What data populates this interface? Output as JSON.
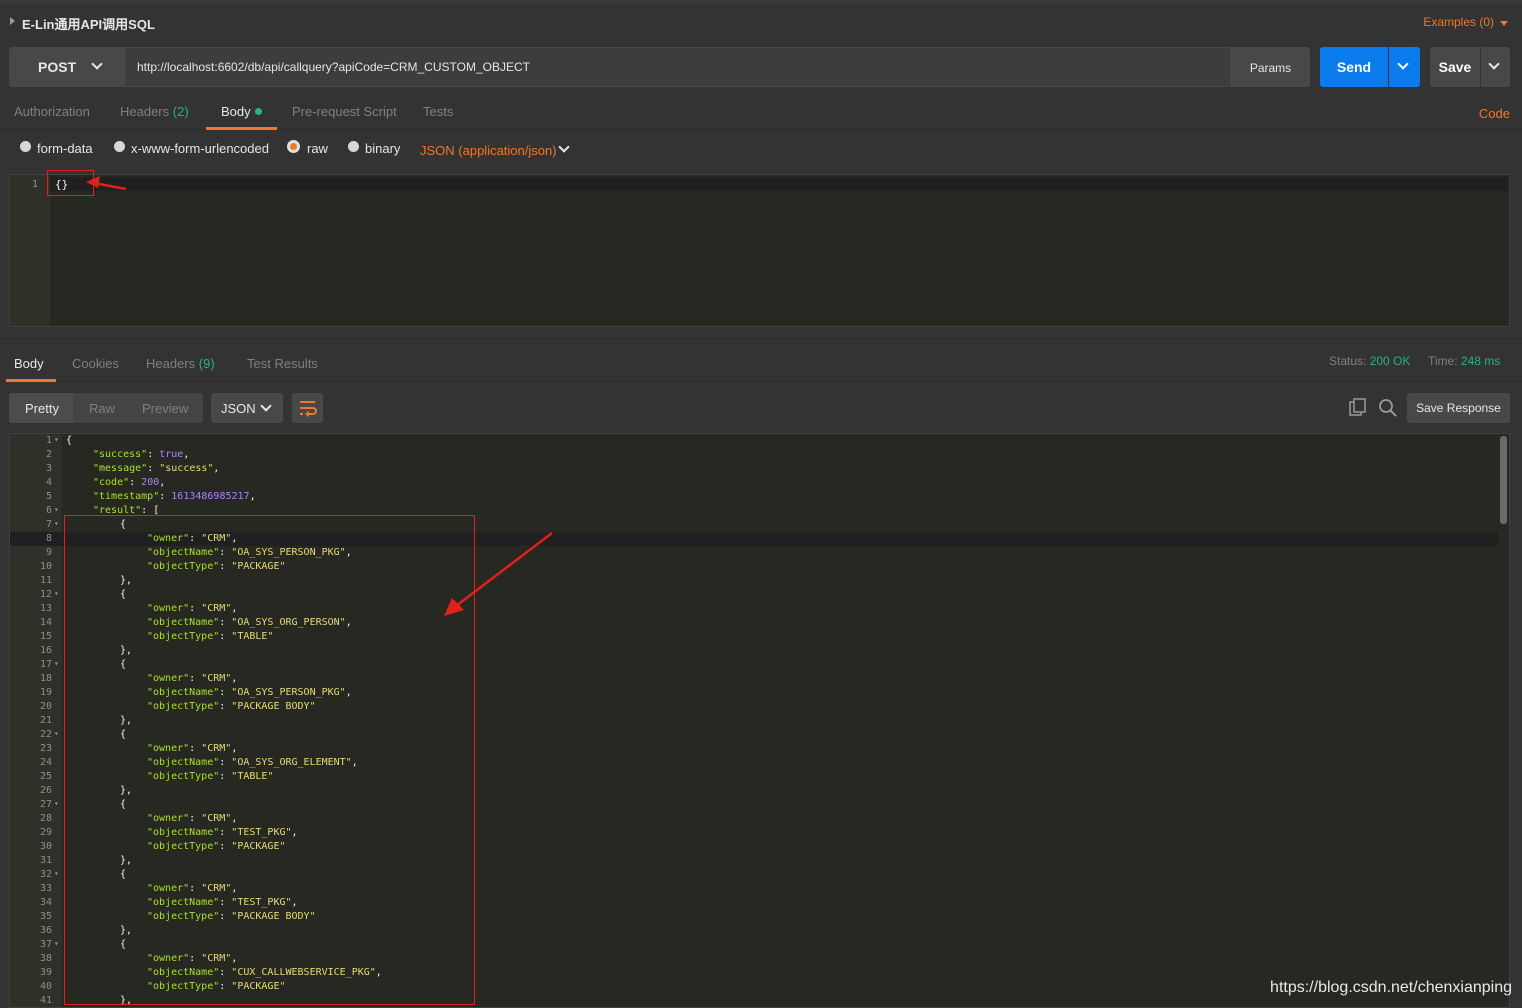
{
  "header": {
    "title": "E-Lin通用API调用SQL",
    "examples_label": "Examples (0)"
  },
  "request": {
    "method": "POST",
    "url": "http://localhost:6602/db/api/callquery?apiCode=CRM_CUSTOM_OBJECT",
    "params_label": "Params",
    "send_label": "Send",
    "save_label": "Save"
  },
  "request_tabs": {
    "authorization": "Authorization",
    "headers": "Headers",
    "headers_count": "(2)",
    "body": "Body",
    "pre_request": "Pre-request Script",
    "tests": "Tests",
    "code_link": "Code"
  },
  "body_options": {
    "form_data": "form-data",
    "urlencoded": "x-www-form-urlencoded",
    "raw": "raw",
    "binary": "binary",
    "content_type": "JSON (application/json)",
    "selected": "raw"
  },
  "request_editor": {
    "line_number": "1",
    "content": "{}"
  },
  "response_tabs": {
    "body": "Body",
    "cookies": "Cookies",
    "headers": "Headers",
    "headers_count": "(9)",
    "test_results": "Test Results"
  },
  "response_status": {
    "status_label": "Status:",
    "status_value": "200 OK",
    "time_label": "Time:",
    "time_value": "248 ms"
  },
  "response_toolbar": {
    "pretty": "Pretty",
    "raw": "Raw",
    "preview": "Preview",
    "format": "JSON",
    "save_response": "Save Response"
  },
  "response_lines": [
    {
      "n": "1",
      "fold": true,
      "indent": 0,
      "tokens": [
        [
          "p",
          "{"
        ]
      ]
    },
    {
      "n": "2",
      "indent": 1,
      "tokens": [
        [
          "k",
          "\"success\""
        ],
        [
          "p",
          ": "
        ],
        [
          "b",
          "true"
        ],
        [
          "p",
          ","
        ]
      ]
    },
    {
      "n": "3",
      "indent": 1,
      "tokens": [
        [
          "k",
          "\"message\""
        ],
        [
          "p",
          ": "
        ],
        [
          "s",
          "\"success\""
        ],
        [
          "p",
          ","
        ]
      ]
    },
    {
      "n": "4",
      "indent": 1,
      "tokens": [
        [
          "k",
          "\"code\""
        ],
        [
          "p",
          ": "
        ],
        [
          "n",
          "200"
        ],
        [
          "p",
          ","
        ]
      ]
    },
    {
      "n": "5",
      "indent": 1,
      "tokens": [
        [
          "k",
          "\"timestamp\""
        ],
        [
          "p",
          ": "
        ],
        [
          "n",
          "1613486985217"
        ],
        [
          "p",
          ","
        ]
      ]
    },
    {
      "n": "6",
      "fold": true,
      "indent": 1,
      "tokens": [
        [
          "k",
          "\"result\""
        ],
        [
          "p",
          ": ["
        ]
      ]
    },
    {
      "n": "7",
      "fold": true,
      "indent": 2,
      "tokens": [
        [
          "p",
          "{"
        ]
      ]
    },
    {
      "n": "8",
      "indent": 3,
      "tokens": [
        [
          "k",
          "\"owner\""
        ],
        [
          "p",
          ": "
        ],
        [
          "s",
          "\"CRM\""
        ],
        [
          "p",
          ","
        ]
      ]
    },
    {
      "n": "9",
      "indent": 3,
      "tokens": [
        [
          "k",
          "\"objectName\""
        ],
        [
          "p",
          ": "
        ],
        [
          "s",
          "\"OA_SYS_PERSON_PKG\""
        ],
        [
          "p",
          ","
        ]
      ]
    },
    {
      "n": "10",
      "indent": 3,
      "tokens": [
        [
          "k",
          "\"objectType\""
        ],
        [
          "p",
          ": "
        ],
        [
          "s",
          "\"PACKAGE\""
        ]
      ]
    },
    {
      "n": "11",
      "indent": 2,
      "tokens": [
        [
          "p",
          "},"
        ]
      ]
    },
    {
      "n": "12",
      "fold": true,
      "indent": 2,
      "tokens": [
        [
          "p",
          "{"
        ]
      ]
    },
    {
      "n": "13",
      "indent": 3,
      "tokens": [
        [
          "k",
          "\"owner\""
        ],
        [
          "p",
          ": "
        ],
        [
          "s",
          "\"CRM\""
        ],
        [
          "p",
          ","
        ]
      ]
    },
    {
      "n": "14",
      "indent": 3,
      "tokens": [
        [
          "k",
          "\"objectName\""
        ],
        [
          "p",
          ": "
        ],
        [
          "s",
          "\"OA_SYS_ORG_PERSON\""
        ],
        [
          "p",
          ","
        ]
      ]
    },
    {
      "n": "15",
      "indent": 3,
      "tokens": [
        [
          "k",
          "\"objectType\""
        ],
        [
          "p",
          ": "
        ],
        [
          "s",
          "\"TABLE\""
        ]
      ]
    },
    {
      "n": "16",
      "indent": 2,
      "tokens": [
        [
          "p",
          "},"
        ]
      ]
    },
    {
      "n": "17",
      "fold": true,
      "indent": 2,
      "tokens": [
        [
          "p",
          "{"
        ]
      ]
    },
    {
      "n": "18",
      "indent": 3,
      "tokens": [
        [
          "k",
          "\"owner\""
        ],
        [
          "p",
          ": "
        ],
        [
          "s",
          "\"CRM\""
        ],
        [
          "p",
          ","
        ]
      ]
    },
    {
      "n": "19",
      "indent": 3,
      "tokens": [
        [
          "k",
          "\"objectName\""
        ],
        [
          "p",
          ": "
        ],
        [
          "s",
          "\"OA_SYS_PERSON_PKG\""
        ],
        [
          "p",
          ","
        ]
      ]
    },
    {
      "n": "20",
      "indent": 3,
      "tokens": [
        [
          "k",
          "\"objectType\""
        ],
        [
          "p",
          ": "
        ],
        [
          "s",
          "\"PACKAGE BODY\""
        ]
      ]
    },
    {
      "n": "21",
      "indent": 2,
      "tokens": [
        [
          "p",
          "},"
        ]
      ]
    },
    {
      "n": "22",
      "fold": true,
      "indent": 2,
      "tokens": [
        [
          "p",
          "{"
        ]
      ]
    },
    {
      "n": "23",
      "indent": 3,
      "tokens": [
        [
          "k",
          "\"owner\""
        ],
        [
          "p",
          ": "
        ],
        [
          "s",
          "\"CRM\""
        ],
        [
          "p",
          ","
        ]
      ]
    },
    {
      "n": "24",
      "indent": 3,
      "tokens": [
        [
          "k",
          "\"objectName\""
        ],
        [
          "p",
          ": "
        ],
        [
          "s",
          "\"OA_SYS_ORG_ELEMENT\""
        ],
        [
          "p",
          ","
        ]
      ]
    },
    {
      "n": "25",
      "indent": 3,
      "tokens": [
        [
          "k",
          "\"objectType\""
        ],
        [
          "p",
          ": "
        ],
        [
          "s",
          "\"TABLE\""
        ]
      ]
    },
    {
      "n": "26",
      "indent": 2,
      "tokens": [
        [
          "p",
          "},"
        ]
      ]
    },
    {
      "n": "27",
      "fold": true,
      "indent": 2,
      "tokens": [
        [
          "p",
          "{"
        ]
      ]
    },
    {
      "n": "28",
      "indent": 3,
      "tokens": [
        [
          "k",
          "\"owner\""
        ],
        [
          "p",
          ": "
        ],
        [
          "s",
          "\"CRM\""
        ],
        [
          "p",
          ","
        ]
      ]
    },
    {
      "n": "29",
      "indent": 3,
      "tokens": [
        [
          "k",
          "\"objectName\""
        ],
        [
          "p",
          ": "
        ],
        [
          "s",
          "\"TEST_PKG\""
        ],
        [
          "p",
          ","
        ]
      ]
    },
    {
      "n": "30",
      "indent": 3,
      "tokens": [
        [
          "k",
          "\"objectType\""
        ],
        [
          "p",
          ": "
        ],
        [
          "s",
          "\"PACKAGE\""
        ]
      ]
    },
    {
      "n": "31",
      "indent": 2,
      "tokens": [
        [
          "p",
          "},"
        ]
      ]
    },
    {
      "n": "32",
      "fold": true,
      "indent": 2,
      "tokens": [
        [
          "p",
          "{"
        ]
      ]
    },
    {
      "n": "33",
      "indent": 3,
      "tokens": [
        [
          "k",
          "\"owner\""
        ],
        [
          "p",
          ": "
        ],
        [
          "s",
          "\"CRM\""
        ],
        [
          "p",
          ","
        ]
      ]
    },
    {
      "n": "34",
      "indent": 3,
      "tokens": [
        [
          "k",
          "\"objectName\""
        ],
        [
          "p",
          ": "
        ],
        [
          "s",
          "\"TEST_PKG\""
        ],
        [
          "p",
          ","
        ]
      ]
    },
    {
      "n": "35",
      "indent": 3,
      "tokens": [
        [
          "k",
          "\"objectType\""
        ],
        [
          "p",
          ": "
        ],
        [
          "s",
          "\"PACKAGE BODY\""
        ]
      ]
    },
    {
      "n": "36",
      "indent": 2,
      "tokens": [
        [
          "p",
          "},"
        ]
      ]
    },
    {
      "n": "37",
      "fold": true,
      "indent": 2,
      "tokens": [
        [
          "p",
          "{"
        ]
      ]
    },
    {
      "n": "38",
      "indent": 3,
      "tokens": [
        [
          "k",
          "\"owner\""
        ],
        [
          "p",
          ": "
        ],
        [
          "s",
          "\"CRM\""
        ],
        [
          "p",
          ","
        ]
      ]
    },
    {
      "n": "39",
      "indent": 3,
      "tokens": [
        [
          "k",
          "\"objectName\""
        ],
        [
          "p",
          ": "
        ],
        [
          "s",
          "\"CUX_CALLWEBSERVICE_PKG\""
        ],
        [
          "p",
          ","
        ]
      ]
    },
    {
      "n": "40",
      "indent": 3,
      "tokens": [
        [
          "k",
          "\"objectType\""
        ],
        [
          "p",
          ": "
        ],
        [
          "s",
          "\"PACKAGE\""
        ]
      ]
    },
    {
      "n": "41",
      "indent": 2,
      "tokens": [
        [
          "p",
          "},"
        ]
      ]
    }
  ],
  "watermark": "https://blog.csdn.net/chenxianping",
  "colors": {
    "accent": "#f0782b",
    "send": "#097bed",
    "success": "#26b47f",
    "annotation": "#e0201b"
  }
}
